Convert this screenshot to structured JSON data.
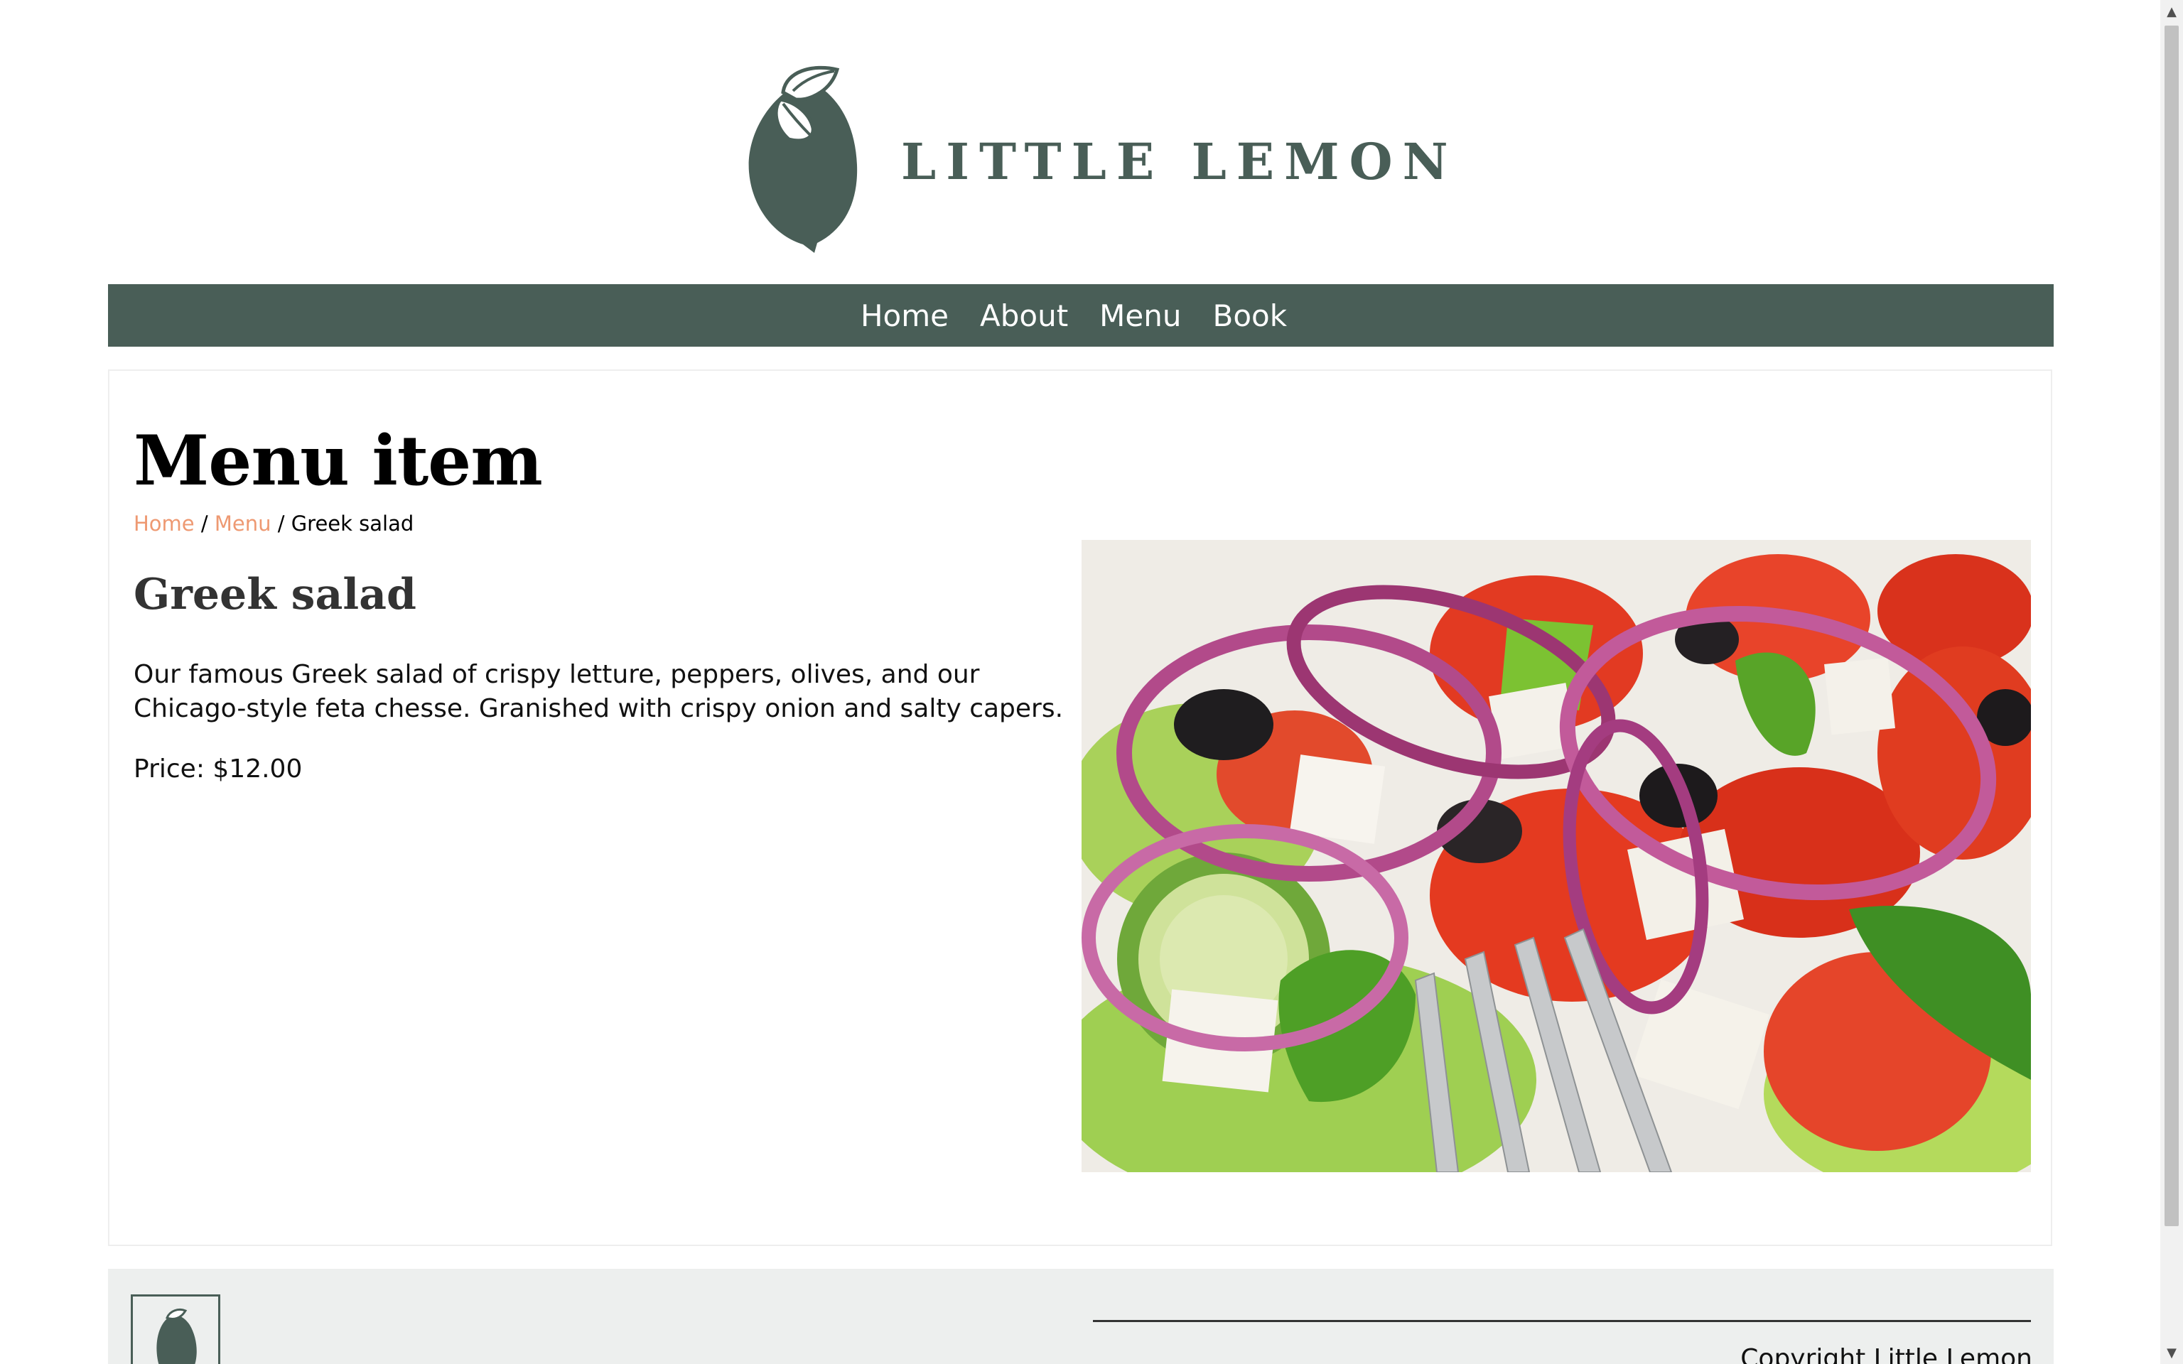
{
  "brand": {
    "name": "LITTLE LEMON",
    "color": "#495e57"
  },
  "nav": {
    "items": [
      {
        "label": "Home"
      },
      {
        "label": "About"
      },
      {
        "label": "Menu"
      },
      {
        "label": "Book"
      }
    ]
  },
  "main": {
    "page_title": "Menu item",
    "breadcrumb": {
      "home": "Home",
      "separator": "/",
      "menu": "Menu",
      "current": "Greek salad"
    },
    "item": {
      "name": "Greek salad",
      "description": "Our famous Greek salad of crispy letture, peppers, olives, and our Chicago-style feta chesse. Granished with crispy onion and salty capers.",
      "price_label": "Price: $12.00",
      "image_icon": "greek-salad-photo"
    }
  },
  "footer": {
    "copyright": "Copyright Little Lemon"
  },
  "colors": {
    "accent": "#ee9972",
    "nav_bg": "#495e57",
    "footer_bg": "#edefee"
  }
}
